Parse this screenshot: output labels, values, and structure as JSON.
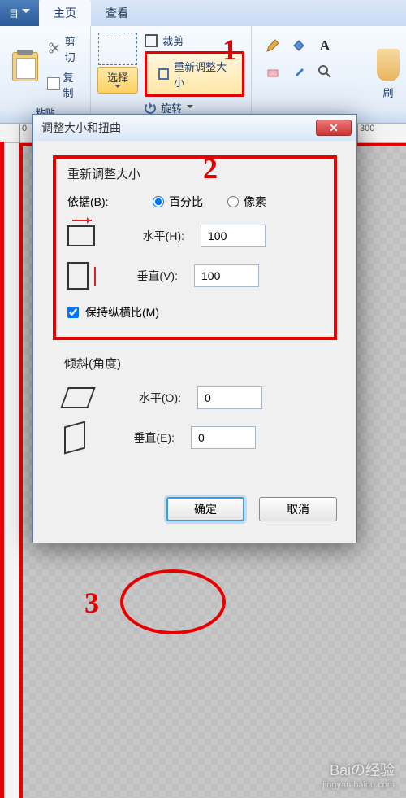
{
  "ribbon": {
    "qat_label": "目",
    "tabs": {
      "home": "主页",
      "view": "查看"
    },
    "clipboard": {
      "paste": "粘贴",
      "cut": "剪切",
      "copy": "复制"
    },
    "image": {
      "select": "选择",
      "crop": "裁剪",
      "resize": "重新调整大小",
      "rotate": "旋转"
    },
    "brush_label": "刷"
  },
  "ruler": {
    "t0": "0",
    "t300": "300"
  },
  "dialog": {
    "title": "调整大小和扭曲",
    "resize": {
      "heading": "重新调整大小",
      "by": "依据(B):",
      "percent": "百分比",
      "pixels": "像素",
      "horizontal_label": "水平(H):",
      "horizontal_value": "100",
      "vertical_label": "垂直(V):",
      "vertical_value": "100",
      "aspect": "保持纵横比(M)"
    },
    "skew": {
      "heading": "倾斜(角度)",
      "horizontal_label": "水平(O):",
      "horizontal_value": "0",
      "vertical_label": "垂直(E):",
      "vertical_value": "0"
    },
    "ok": "确定",
    "cancel": "取消"
  },
  "annotations": {
    "a1": "1",
    "a2": "2",
    "a3": "3"
  },
  "watermark": {
    "brand": "Baiの经验",
    "url": "jingyan.baidu.com"
  }
}
